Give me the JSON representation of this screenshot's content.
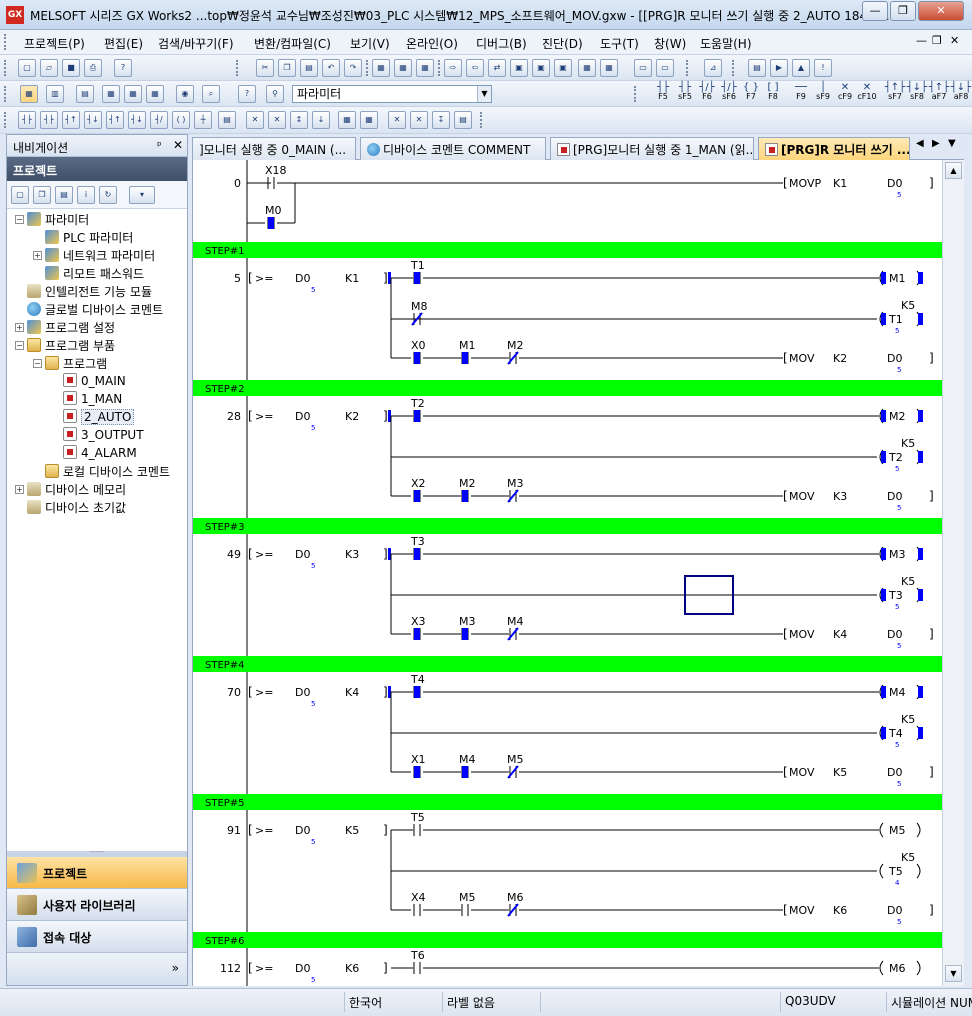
{
  "window": {
    "title": "MELSOFT 시리즈 GX Works2 ...top₩정윤석 교수님₩조성진₩03_PLC 시스템₩12_MPS_소프트웨어_MOV.gxw - [[PRG]R 모니터 쓰기 실행 중 2_AUTO 184스...",
    "app_icon_text": "GX",
    "minimize": "—",
    "restore": "❐",
    "close": "✕"
  },
  "menu": {
    "items": [
      "프로젝트(P)",
      "편집(E)",
      "검색/바꾸기(F)",
      "변환/컴파일(C)",
      "보기(V)",
      "온라인(O)",
      "디버그(B)",
      "진단(D)",
      "도구(T)",
      "창(W)",
      "도움말(H)"
    ],
    "mdi_min": "—",
    "mdi_restore": "❐",
    "mdi_close": "✕"
  },
  "toolbar2": {
    "search_value": "파라미터",
    "fkeys": [
      {
        "sym": "┤├",
        "label": "F5"
      },
      {
        "sym": "┤├",
        "label": "sF5"
      },
      {
        "sym": "┤/├",
        "label": "F6"
      },
      {
        "sym": "┤/├",
        "label": "sF6"
      },
      {
        "sym": "{ }",
        "label": "F7"
      },
      {
        "sym": "[ ]",
        "label": "F8"
      },
      {
        "sym": "──",
        "label": "F9"
      },
      {
        "sym": "│",
        "label": "sF9"
      },
      {
        "sym": "✕",
        "label": "cF9"
      },
      {
        "sym": "✕",
        "label": "cF10"
      },
      {
        "sym": "┤↑├",
        "label": "sF7"
      },
      {
        "sym": "┤↓├",
        "label": "sF8"
      },
      {
        "sym": "┤↑├",
        "label": "aF7"
      },
      {
        "sym": "┤↓├",
        "label": "aF8"
      }
    ]
  },
  "nav": {
    "title": "내비게이션",
    "pin": "ᵖ",
    "close": "✕",
    "section": "프로젝트",
    "tree": [
      {
        "label": "파라미터",
        "level": 0,
        "icon": "param",
        "exp": "−"
      },
      {
        "label": "PLC 파라미터",
        "level": 1,
        "icon": "param"
      },
      {
        "label": "네트워크 파라미터",
        "level": 1,
        "icon": "param",
        "exp": "+"
      },
      {
        "label": "리모트 패스워드",
        "level": 1,
        "icon": "param"
      },
      {
        "label": "인텔리전트 기능 모듈",
        "level": 0,
        "icon": "dev"
      },
      {
        "label": "글로벌 디바이스 코멘트",
        "level": 0,
        "icon": "globe"
      },
      {
        "label": "프로그램 설정",
        "level": 0,
        "icon": "param",
        "exp": "+"
      },
      {
        "label": "프로그램 부품",
        "level": 0,
        "icon": "folder",
        "exp": "−"
      },
      {
        "label": "프로그램",
        "level": 1,
        "icon": "folder",
        "exp": "−"
      },
      {
        "label": "0_MAIN",
        "level": 2,
        "icon": "prog"
      },
      {
        "label": "1_MAN",
        "level": 2,
        "icon": "prog"
      },
      {
        "label": "2_AUTO",
        "level": 2,
        "icon": "prog",
        "selected": true
      },
      {
        "label": "3_OUTPUT",
        "level": 2,
        "icon": "prog"
      },
      {
        "label": "4_ALARM",
        "level": 2,
        "icon": "prog"
      },
      {
        "label": "로컬 디바이스 코멘트",
        "level": 1,
        "icon": "folder"
      },
      {
        "label": "디바이스 메모리",
        "level": 0,
        "icon": "dev",
        "exp": "+"
      },
      {
        "label": "디바이스 초기값",
        "level": 0,
        "icon": "dev"
      }
    ],
    "bottom": [
      {
        "label": "프로젝트",
        "active": true
      },
      {
        "label": "사용자 라이브러리",
        "active": false
      },
      {
        "label": "접속 대상",
        "active": false
      }
    ],
    "more": "»"
  },
  "tabs": [
    {
      "label": "]모니터 실행 중 0_MAIN (...",
      "active": false
    },
    {
      "label": "디바이스 코멘트 COMMENT",
      "active": false
    },
    {
      "label": "[PRG]모니터 실행 중 1_MAN (읽...",
      "active": false
    },
    {
      "label": "[PRG]R 모니터 쓰기 ...",
      "active": true
    }
  ],
  "tab_nav": {
    "left": "◀",
    "right": "▶",
    "menu": "▼"
  },
  "ladder": {
    "rungs": [
      {
        "step": "0",
        "kind": "first",
        "c1": "X18",
        "c2": "M0",
        "inst": "MOVP",
        "src": "K1",
        "dst": "D0",
        "dval": "5"
      },
      {
        "header": "STEP#1",
        "step": "5",
        "cmpSrc": "K1",
        "t": "T1",
        "latch": "M1",
        "m": "M8",
        "k": "K5",
        "x": "X0",
        "ma": "M1",
        "mb": "M2",
        "movSrc": "K2",
        "dval": "5",
        "tval": "5",
        "cmpVal": "5",
        "s1": true,
        "s3": "on-on-off"
      },
      {
        "header": "STEP#2",
        "step": "28",
        "cmpSrc": "K2",
        "t": "T2",
        "latch": "M2",
        "k": "K5",
        "x": "X2",
        "ma": "M2",
        "mb": "M3",
        "movSrc": "K3",
        "dval": "5",
        "tval": "5",
        "cmpVal": "5"
      },
      {
        "header": "STEP#3",
        "step": "49",
        "cmpSrc": "K3",
        "t": "T3",
        "latch": "M3",
        "k": "K5",
        "x": "X3",
        "ma": "M3",
        "mb": "M4",
        "movSrc": "K4",
        "dval": "5",
        "tval": "5",
        "cmpVal": "5",
        "cursor": true
      },
      {
        "header": "STEP#4",
        "step": "70",
        "cmpSrc": "K4",
        "t": "T4",
        "latch": "M4",
        "k": "K5",
        "x": "X1",
        "ma": "M4",
        "mb": "M5",
        "movSrc": "K5",
        "dval": "5",
        "tval": "5",
        "cmpVal": "5"
      },
      {
        "header": "STEP#5",
        "step": "91",
        "cmpSrc": "K5",
        "t": "T5",
        "latch": "M5",
        "k": "K5",
        "x": "X4",
        "ma": "M5",
        "mb": "M6",
        "movSrc": "K6",
        "dval": "5",
        "tval": "4",
        "cmpVal": "5",
        "inactive": true
      },
      {
        "header": "STEP#6",
        "step": "112",
        "cmpSrc": "K6",
        "t": "T6",
        "latch": "M6",
        "partial": true,
        "cmpVal": "5",
        "inactive": true
      }
    ],
    "first_label": "MOVP",
    "cmp_label": ">=",
    "mov_label": "MOV",
    "cmp_dst": "D0",
    "mov_dst": "D0",
    "colors": {
      "header": "#00ff00",
      "active": "#0000ff",
      "rail": "#000000"
    }
  },
  "status": {
    "language": "한국어",
    "label": "라벨 없음",
    "cpu": "Q03UDV",
    "mode": "시뮬레이션 NUM"
  }
}
